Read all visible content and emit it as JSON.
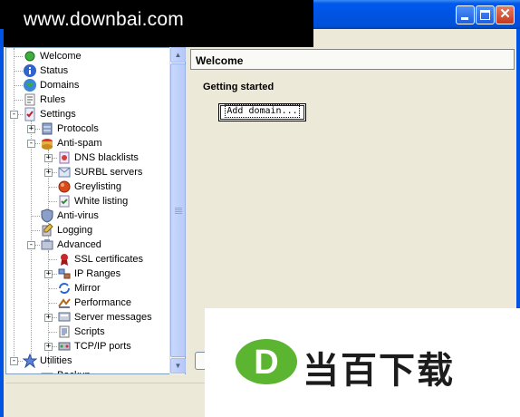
{
  "watermark": {
    "site": "www.downbai.com",
    "logo_text": "当百下载",
    "logo_letter": "D"
  },
  "titlebar": {
    "buttons": [
      "minimize",
      "maximize",
      "close"
    ]
  },
  "tree": {
    "items": [
      {
        "label": "Welcome",
        "icon": "green-dot-icon",
        "indent": 0,
        "expander": ""
      },
      {
        "label": "Status",
        "icon": "info-icon",
        "indent": 0,
        "expander": ""
      },
      {
        "label": "Domains",
        "icon": "globe-icon",
        "indent": 0,
        "expander": ""
      },
      {
        "label": "Rules",
        "icon": "rules-icon",
        "indent": 0,
        "expander": ""
      },
      {
        "label": "Settings",
        "icon": "settings-icon",
        "indent": 0,
        "expander": "-"
      },
      {
        "label": "Protocols",
        "icon": "server-icon",
        "indent": 1,
        "expander": "+"
      },
      {
        "label": "Anti-spam",
        "icon": "antispam-icon",
        "indent": 1,
        "expander": "-"
      },
      {
        "label": "DNS blacklists",
        "icon": "blacklist-icon",
        "indent": 2,
        "expander": "+"
      },
      {
        "label": "SURBL servers",
        "icon": "surbl-icon",
        "indent": 2,
        "expander": "+"
      },
      {
        "label": "Greylisting",
        "icon": "greylist-icon",
        "indent": 2,
        "expander": ""
      },
      {
        "label": "White listing",
        "icon": "whitelist-icon",
        "indent": 2,
        "expander": ""
      },
      {
        "label": "Anti-virus",
        "icon": "shield-icon",
        "indent": 1,
        "expander": ""
      },
      {
        "label": "Logging",
        "icon": "logging-icon",
        "indent": 1,
        "expander": ""
      },
      {
        "label": "Advanced",
        "icon": "advanced-icon",
        "indent": 1,
        "expander": "-"
      },
      {
        "label": "SSL certificates",
        "icon": "certificate-icon",
        "indent": 2,
        "expander": ""
      },
      {
        "label": "IP Ranges",
        "icon": "ip-range-icon",
        "indent": 2,
        "expander": "+"
      },
      {
        "label": "Mirror",
        "icon": "mirror-icon",
        "indent": 2,
        "expander": ""
      },
      {
        "label": "Performance",
        "icon": "performance-icon",
        "indent": 2,
        "expander": ""
      },
      {
        "label": "Server messages",
        "icon": "messages-icon",
        "indent": 2,
        "expander": "+"
      },
      {
        "label": "Scripts",
        "icon": "scripts-icon",
        "indent": 2,
        "expander": ""
      },
      {
        "label": "TCP/IP ports",
        "icon": "ports-icon",
        "indent": 2,
        "expander": "+"
      },
      {
        "label": "Utilities",
        "icon": "star-icon",
        "indent": 0,
        "expander": "-"
      },
      {
        "label": "Backup",
        "icon": "backup-icon",
        "indent": 1,
        "expander": ""
      }
    ]
  },
  "main": {
    "header": "Welcome",
    "section_title": "Getting started",
    "add_domain_label": "Add domain..."
  },
  "colors": {
    "titlebar": "#0054e3",
    "frame": "#ece9d8",
    "logo_green": "#5cb531"
  }
}
